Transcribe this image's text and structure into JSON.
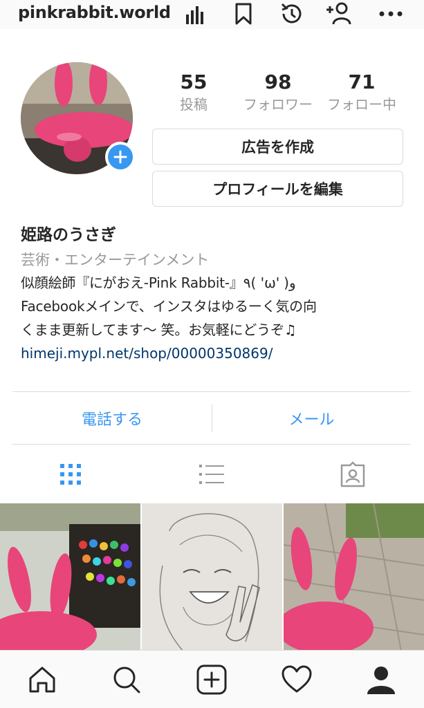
{
  "header": {
    "username": "pinkrabbit.world",
    "icons": [
      "insights-icon",
      "bookmark-icon",
      "history-icon",
      "add-person-icon",
      "more-icon"
    ]
  },
  "profile": {
    "stats": [
      {
        "value": "55",
        "label": "投稿"
      },
      {
        "value": "98",
        "label": "フォロワー"
      },
      {
        "value": "71",
        "label": "フォロー中"
      }
    ],
    "buttons": {
      "create_ad": "広告を作成",
      "edit_profile": "プロフィールを編集"
    }
  },
  "bio": {
    "name": "姫路のうさぎ",
    "category": "芸術・エンターテインメント",
    "description": "似顔絵師『にがおえ-Pink Rabbit-』٩( 'ω' )و\nFacebookメインで、インスタはゆるーく気の向\nくまま更新してます〜 笑。お気軽にどうぞ♫",
    "link": "himeji.mypl.net/shop/00000350869/"
  },
  "contact": {
    "call": "電話する",
    "email": "メール"
  },
  "tabs": [
    "grid-view-icon",
    "list-view-icon",
    "tagged-icon"
  ],
  "grid": [
    "pink-rabbit-with-markers",
    "sketch-of-smiling-girl",
    "pink-rabbit-outdoors"
  ],
  "bottom_nav": [
    "home-icon",
    "search-icon",
    "new-post-icon",
    "activity-heart-icon",
    "profile-icon"
  ],
  "colors": {
    "accent": "#3897f0",
    "link": "#003569",
    "text": "#262626",
    "muted": "#999999",
    "border": "#dbdbdb",
    "rabbit_pink": "#e8457a"
  }
}
